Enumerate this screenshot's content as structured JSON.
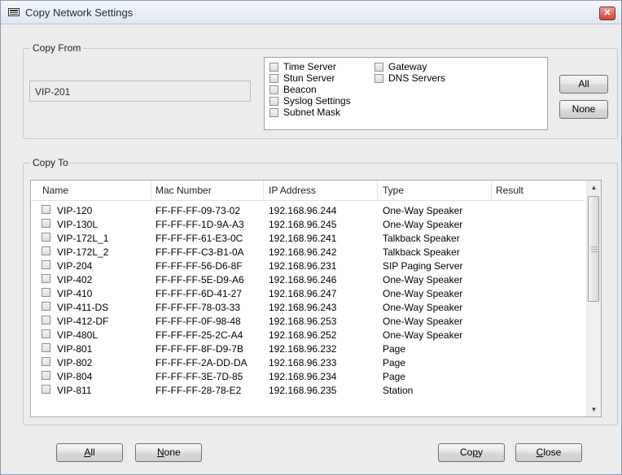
{
  "window": {
    "title": "Copy Network Settings",
    "close_glyph": "✕"
  },
  "copy_from": {
    "label": "Copy From",
    "source": "VIP-201",
    "options": [
      {
        "label": "Time Server"
      },
      {
        "label": "Stun Server"
      },
      {
        "label": "Beacon"
      },
      {
        "label": "Syslog Settings"
      },
      {
        "label": "Subnet Mask"
      },
      {
        "label": "Gateway"
      },
      {
        "label": "DNS Servers"
      }
    ],
    "all_label": "All",
    "none_label": "None"
  },
  "copy_to": {
    "label": "Copy To",
    "columns": [
      "Name",
      "Mac Number",
      "IP Address",
      "Type",
      "Result"
    ],
    "rows": [
      {
        "name": "VIP-120",
        "mac": "FF-FF-FF-09-73-02",
        "ip": "192.168.96.244",
        "type": "One-Way Speaker",
        "result": ""
      },
      {
        "name": "VIP-130L",
        "mac": "FF-FF-FF-1D-9A-A3",
        "ip": "192.168.96.245",
        "type": "One-Way Speaker",
        "result": ""
      },
      {
        "name": "VIP-172L_1",
        "mac": "FF-FF-FF-61-E3-0C",
        "ip": "192.168.96.241",
        "type": "Talkback Speaker",
        "result": ""
      },
      {
        "name": "VIP-172L_2",
        "mac": "FF-FF-FF-C3-B1-0A",
        "ip": "192.168.96.242",
        "type": "Talkback Speaker",
        "result": ""
      },
      {
        "name": "VIP-204",
        "mac": "FF-FF-FF-56-D6-8F",
        "ip": "192.168.96.231",
        "type": "SIP Paging Server",
        "result": ""
      },
      {
        "name": "VIP-402",
        "mac": "FF-FF-FF-5E-D9-A6",
        "ip": "192.168.96.246",
        "type": "One-Way Speaker",
        "result": ""
      },
      {
        "name": "VIP-410",
        "mac": "FF-FF-FF-6D-41-27",
        "ip": "192.168.96.247",
        "type": "One-Way Speaker",
        "result": ""
      },
      {
        "name": "VIP-411-DS",
        "mac": "FF-FF-FF-78-03-33",
        "ip": "192.168.96.243",
        "type": "One-Way Speaker",
        "result": ""
      },
      {
        "name": "VIP-412-DF",
        "mac": "FF-FF-FF-0F-98-48",
        "ip": "192.168.96.253",
        "type": "One-Way Speaker",
        "result": ""
      },
      {
        "name": "VIP-480L",
        "mac": "FF-FF-FF-25-2C-A4",
        "ip": "192.168.96.252",
        "type": "One-Way Speaker",
        "result": ""
      },
      {
        "name": "VIP-801",
        "mac": "FF-FF-FF-8F-D9-7B",
        "ip": "192.168.96.232",
        "type": "Page",
        "result": ""
      },
      {
        "name": "VIP-802",
        "mac": "FF-FF-FF-2A-DD-DA",
        "ip": "192.168.96.233",
        "type": "Page",
        "result": ""
      },
      {
        "name": "VIP-804",
        "mac": "FF-FF-FF-3E-7D-85",
        "ip": "192.168.96.234",
        "type": "Page",
        "result": ""
      },
      {
        "name": "VIP-811",
        "mac": "FF-FF-FF-28-78-E2",
        "ip": "192.168.96.235",
        "type": "Station",
        "result": ""
      }
    ]
  },
  "footer": {
    "all_key": "A",
    "all_rest": "ll",
    "none_key": "N",
    "none_rest": "one",
    "copy_start": "Co",
    "copy_key": "p",
    "copy_rest": "y",
    "close_key": "C",
    "close_rest": "lose"
  }
}
